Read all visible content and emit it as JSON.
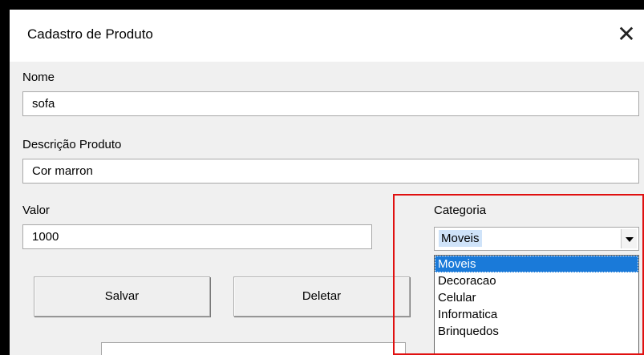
{
  "window": {
    "title": "Cadastro de Produto"
  },
  "form": {
    "nome": {
      "label": "Nome",
      "value": "sofa"
    },
    "descricao": {
      "label": "Descrição Produto",
      "value": "Cor marron"
    },
    "valor": {
      "label": "Valor",
      "value": "1000"
    },
    "categoria": {
      "label": "Categoria",
      "selected": "Moveis",
      "options": [
        "Moveis",
        "Decoracao",
        "Celular",
        "Informatica",
        "Brinquedos"
      ]
    }
  },
  "buttons": {
    "salvar": "Salvar",
    "deletar": "Deletar"
  },
  "colors": {
    "highlight": "#e01010",
    "selection": "#1a7ad9"
  }
}
